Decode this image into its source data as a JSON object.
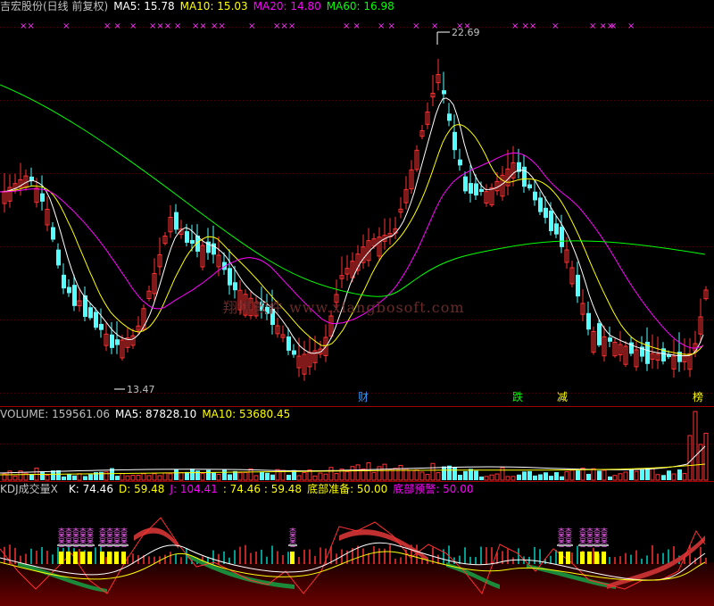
{
  "colors": {
    "up": "#ff3232",
    "down": "#54ffff",
    "ma5": "#ffffff",
    "ma10": "#ffff00",
    "ma20": "#ff00ff",
    "ma60": "#00ff00",
    "grid": "#8b0000",
    "text": "#c0c0c0"
  },
  "price_panel": {
    "title": "吉宏股份(日线 前复权)",
    "ma5": "MA5: 15.78",
    "ma10": "MA10: 15.03",
    "ma20": "MA20: 14.80",
    "ma60": "MA60: 16.98",
    "high_label": "22.69",
    "low_label": "13.47",
    "x_marks": [
      "××",
      "×",
      "× ×",
      "×",
      "×××",
      "×",
      "××",
      "××",
      "×",
      "××",
      "×",
      "× ×",
      "× ×",
      "×",
      "×",
      "××",
      "× ××",
      "×",
      "× ××",
      "×",
      "×"
    ],
    "tags": [
      {
        "text": "财",
        "color": "#3399ff"
      },
      {
        "text": "跌",
        "color": "#00ff00"
      },
      {
        "text": "减",
        "color": "#ffff00"
      },
      {
        "text": "榜",
        "color": "#ffff00"
      }
    ],
    "watermark": "翔博软件 www.xiangbosoft.com"
  },
  "volume_panel": {
    "volume": "VOLUME: 159561.06",
    "ma5": "MA5: 87828.10",
    "ma10": "MA10: 53680.45"
  },
  "kdj_panel": {
    "name": "KDJ成交量X",
    "k": "K: 74.46",
    "d": "D: 59.48",
    "j": "J: 104.41",
    "extra": ": 74.46 : 59.48",
    "bottom_prep": "底部准备: 50.00",
    "bottom_warn": "底部预警: 50.00",
    "char": "杏"
  }
}
